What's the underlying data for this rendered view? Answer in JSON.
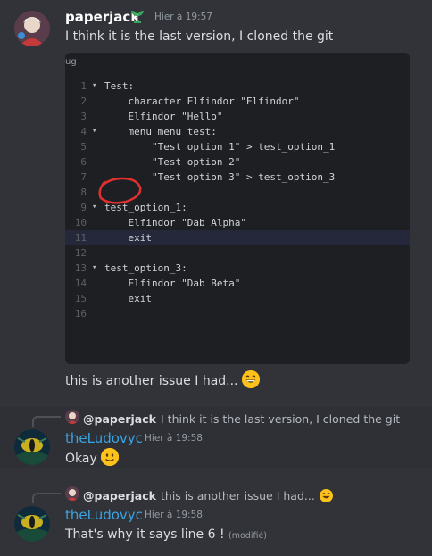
{
  "messages": {
    "first": {
      "author": "paperjack",
      "timestamp": "Hier à 19:57",
      "text": "I think it is the last version, I cloned the git",
      "code_header": "ug",
      "code_lines": [
        {
          "n": "1",
          "fold": "▾",
          "code": "Test:"
        },
        {
          "n": "2",
          "fold": "",
          "code": "    character Elfindor \"Elfindor\""
        },
        {
          "n": "3",
          "fold": "",
          "code": "    Elfindor \"Hello\""
        },
        {
          "n": "4",
          "fold": "▾",
          "code": "    menu menu_test:"
        },
        {
          "n": "5",
          "fold": "",
          "code": "        \"Test option 1\" > test_option_1"
        },
        {
          "n": "6",
          "fold": "",
          "code": "        \"Test option 2\""
        },
        {
          "n": "7",
          "fold": "",
          "code": "        \"Test option 3\" > test_option_3"
        },
        {
          "n": "8",
          "fold": "",
          "code": ""
        },
        {
          "n": "9",
          "fold": "▾",
          "code": "test_option_1:"
        },
        {
          "n": "10",
          "fold": "",
          "code": "    Elfindor \"Dab Alpha\""
        },
        {
          "n": "11",
          "fold": "",
          "code": "    exit"
        },
        {
          "n": "12",
          "fold": "",
          "code": ""
        },
        {
          "n": "13",
          "fold": "▾",
          "code": "test_option_3:"
        },
        {
          "n": "14",
          "fold": "",
          "code": "    Elfindor \"Dab Beta\""
        },
        {
          "n": "15",
          "fold": "",
          "code": "    exit"
        },
        {
          "n": "16",
          "fold": "",
          "code": ""
        }
      ],
      "followup_text": "this is another issue I had..."
    },
    "reply1": {
      "replied_author": "@paperjack",
      "replied_text": "I think it is the last version, I cloned the git",
      "author": "theLudovyc",
      "timestamp": "Hier à 19:58",
      "text": "Okay"
    },
    "reply2": {
      "replied_author": "@paperjack",
      "replied_text": "this is another issue I had...",
      "author": "theLudovyc",
      "timestamp": "Hier à 19:58",
      "text": "That's why it says line 6 !",
      "edited_label": "(modifié)"
    }
  },
  "colors": {
    "background": "#313338",
    "author_green_name": "#ffffff",
    "author_blue_name": "#3aa3e0",
    "annotation_red": "#e0302f"
  },
  "icons": [
    "sprout-badge-icon",
    "grinning-emoji-icon",
    "slight-smile-emoji-icon"
  ]
}
